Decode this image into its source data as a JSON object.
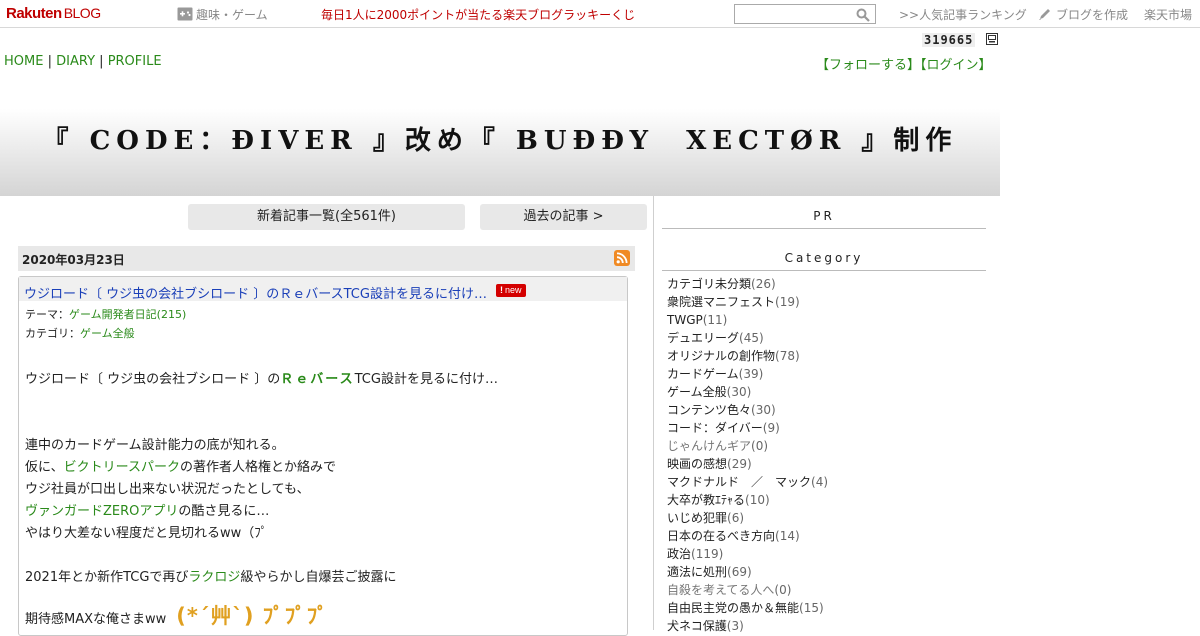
{
  "topbar": {
    "logo_main": "Rakuten",
    "logo_sub": "BLOG",
    "genre": "趣味・ゲーム",
    "lottery": "毎日1人に2000ポイントが当たる楽天ブログラッキーくじ",
    "search_placeholder": "",
    "ranking": ">>人気記事ランキング",
    "make_blog": "ブログを作成",
    "ichiba": "楽天市場"
  },
  "counter": "319665",
  "nav": {
    "home": "HOME",
    "diary": "DIARY",
    "profile": "PROFILE",
    "sep": "|",
    "follow": "【フォローする】",
    "login": "【ログイン】"
  },
  "blog_title": "『 CODE：ÐIVER 』改め『 BUÐÐY　XECTØR 』制作",
  "buttons": {
    "new_list": "新着記事一覧(全561件)",
    "past": "過去の記事 >"
  },
  "post": {
    "date": "2020年03月23日",
    "title": "ウジロード〔 ウジ虫の会社ブシロード 〕のＲｅバースTCG設計を見るに付け…",
    "new_badge": "new",
    "theme_label": "テーマ：",
    "theme_value": "ゲーム開発者日記(215)",
    "category_label": "カテゴリ：",
    "category_value": "ゲーム全般",
    "lines": [
      {
        "a": "ウジロード〔 ウジ虫の会社ブシロード 〕の",
        "link": "Ｒｅバース",
        "b": "TCG設計を見るに付け…"
      },
      {
        "a": "連中のカードゲーム設計能力の底が知れる。"
      },
      {
        "a": "仮に、",
        "link": "ビクトリースパーク",
        "b": "の著作者人格権とか絡みで"
      },
      {
        "a": "ウジ社員が口出し出来ない状況だったとしても、"
      },
      {
        "link": "ヴァンガードZEROアプリ",
        "b": "の酷さ見るに…"
      },
      {
        "a": "やはり大差ない程度だと見切れるww（ﾌﾟ"
      },
      {
        "a": "2021年とか新作TCGで再び",
        "link": "ラクロジ",
        "b": "級やらかし自爆芸ご披露に"
      },
      {
        "a": "期待感MAXな俺さまww",
        "emote": "(*´艸`) ﾌﾟﾌﾟﾌﾟ"
      }
    ]
  },
  "sidebar": {
    "pr": "PR",
    "category_heading": "Category",
    "categories": [
      {
        "name": "カテゴリ未分類",
        "count": "(26)"
      },
      {
        "name": "衆院選マニフェスト",
        "count": "(19)"
      },
      {
        "name": "TWGP",
        "count": "(11)"
      },
      {
        "name": "デュエリーグ",
        "count": "(45)"
      },
      {
        "name": "オリジナルの創作物",
        "count": "(78)"
      },
      {
        "name": "カードゲーム",
        "count": "(39)"
      },
      {
        "name": "ゲーム全般",
        "count": "(30)"
      },
      {
        "name": "コンテンツ色々",
        "count": "(30)"
      },
      {
        "name": "コード：ダイバー",
        "count": "(9)"
      },
      {
        "name": "じゃんけんギア",
        "count": "(0)"
      },
      {
        "name": "映画の感想",
        "count": "(29)"
      },
      {
        "name": "マクドナルド　／　マック",
        "count": "(4)"
      },
      {
        "name": "大卒が教ｴﾃｬる",
        "count": "(10)"
      },
      {
        "name": "いじめ犯罪",
        "count": "(6)"
      },
      {
        "name": "日本の在るべき方向",
        "count": "(14)"
      },
      {
        "name": "政治",
        "count": "(119)"
      },
      {
        "name": "適法に処刑",
        "count": "(69)"
      },
      {
        "name": "自殺を考えてる人へ",
        "count": "(0)"
      },
      {
        "name": "自由民主党の愚か＆無能",
        "count": "(15)"
      },
      {
        "name": "犬ネコ保護",
        "count": "(3)"
      }
    ]
  },
  "colors": {
    "brand_red": "#bf0000",
    "link_green": "#2a8a1a",
    "title_blue": "#1a3fb8",
    "emote_orange": "#e0a020"
  },
  "icons": [
    "gamepad-icon",
    "search-icon",
    "pencil-icon",
    "counter-icon",
    "rss-icon"
  ]
}
